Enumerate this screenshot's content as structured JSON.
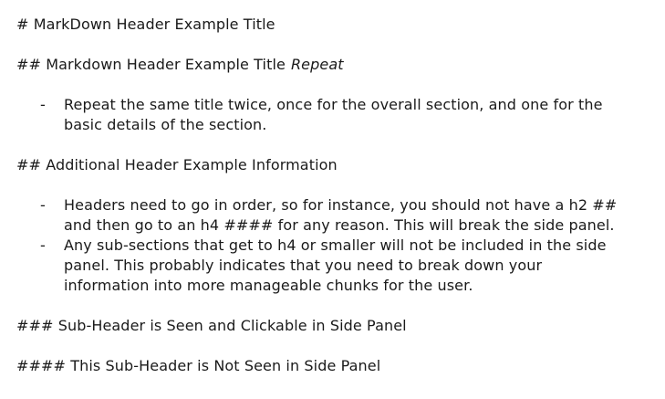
{
  "heading1": "# MarkDown Header Example Title",
  "heading2": {
    "text": "## Markdown Header Example Title",
    "emphasis": "Repeat"
  },
  "section1_bullets": [
    {
      "dash": "-",
      "lines": [
        "Repeat the same title twice, once for the overall section, and one for the",
        "basic details of the section."
      ]
    }
  ],
  "heading3": "## Additional Header Example Information",
  "section2_bullets": [
    {
      "dash": "-",
      "lines": [
        "Headers need to go in order, so for instance, you should not have a h2 ##",
        "and then go to an h4 #### for any reason. This will break the side panel."
      ]
    },
    {
      "dash": "-",
      "lines": [
        "Any sub-sections that get to h4 or smaller will not be included in the side",
        "panel. This probably indicates that you need to break down your",
        "information into more manageable chunks for the user."
      ]
    }
  ],
  "heading4": "### Sub-Header is Seen and Clickable in Side Panel",
  "heading5": "#### This Sub-Header is Not Seen in Side Panel"
}
